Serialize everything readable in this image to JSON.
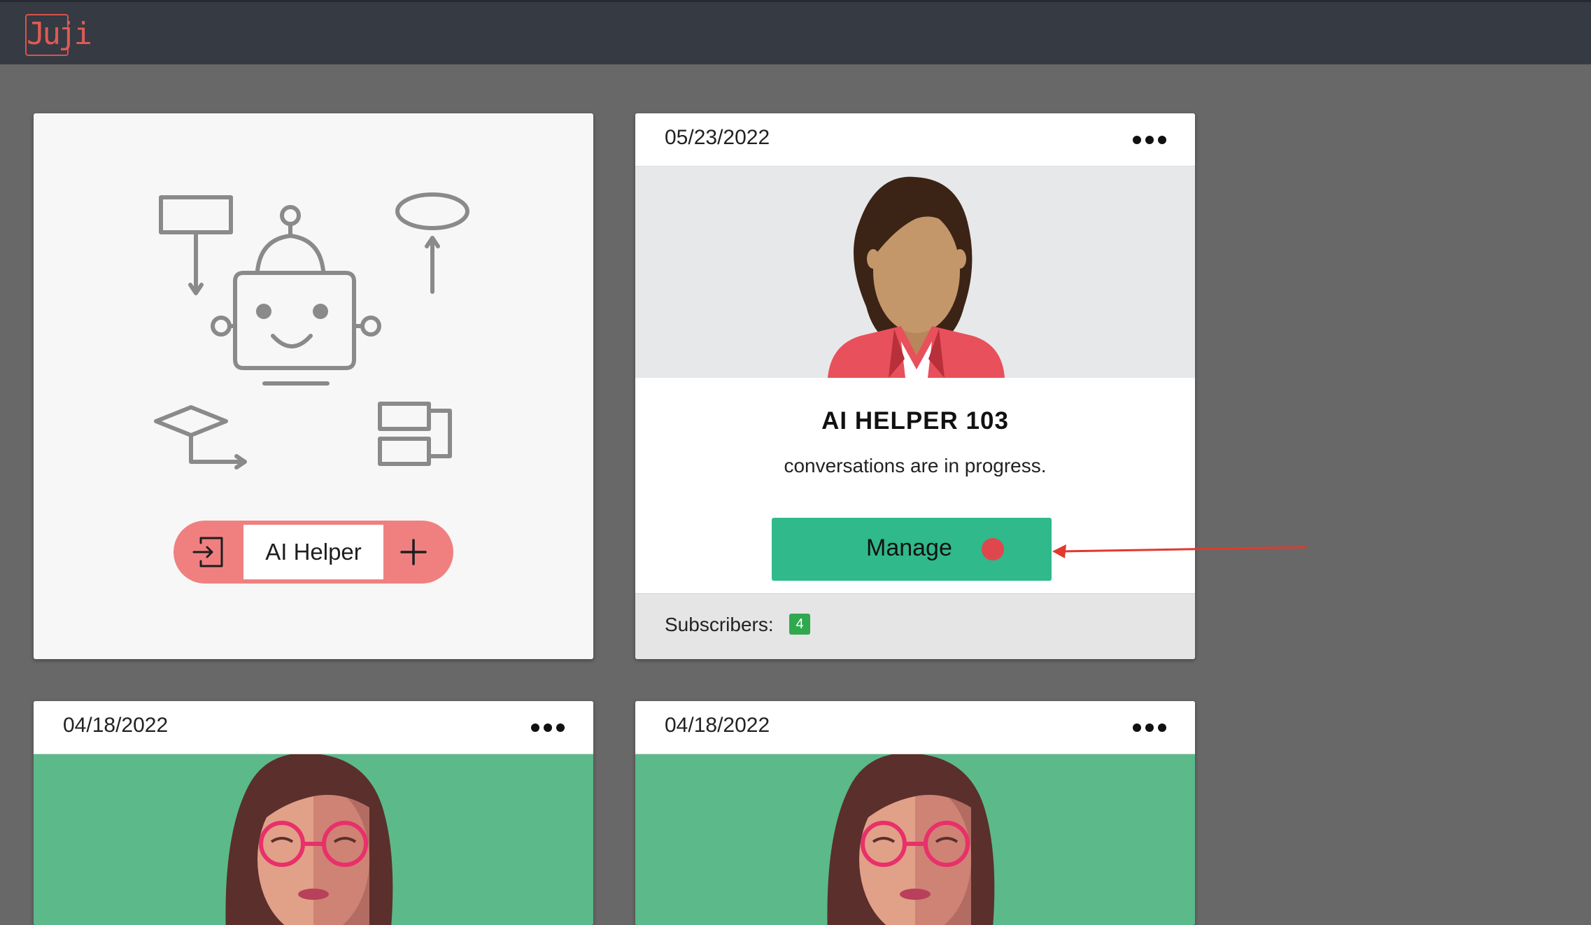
{
  "app": {
    "logo_text": "Juji"
  },
  "create_card": {
    "pill_label": "AI Helper"
  },
  "cards": [
    {
      "date": "05/23/2022",
      "title": "AI HELPER 103",
      "description": "conversations are in progress.",
      "manage_label": "Manage",
      "subscribers_label": "Subscribers:",
      "subscribers_count": "4"
    },
    {
      "date": "04/18/2022"
    },
    {
      "date": "04/18/2022"
    }
  ],
  "colors": {
    "topbar": "#353a43",
    "background": "#686868",
    "manage_button": "#30b98a",
    "status_dot": "#e0464e",
    "pill": "#f08080",
    "badge": "#2fa84f",
    "annotation_arrow": "#e03a2f"
  },
  "icons": {
    "logo": "juji-logo",
    "import": "import-icon",
    "add": "plus-icon",
    "more": "more-dots-icon"
  }
}
